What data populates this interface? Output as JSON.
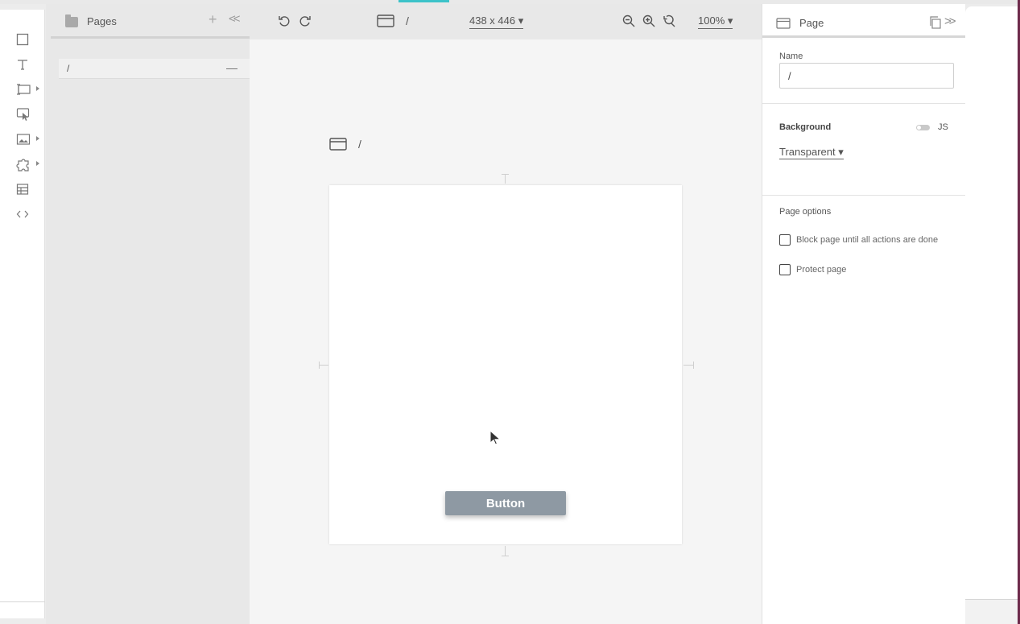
{
  "pages_panel": {
    "title": "Pages",
    "add_label": "+",
    "collapse_label": "<<",
    "pages": [
      {
        "label": "/"
      }
    ]
  },
  "canvas_toolbar": {
    "breadcrumb": "/",
    "size_label": "438 x 446 ▾",
    "zoom_label": "100% ▾"
  },
  "canvas": {
    "frame_title": "/",
    "button_label": "Button"
  },
  "properties": {
    "title": "Page",
    "expand_label": ">>",
    "name_label": "Name",
    "name_value": "/",
    "background_label": "Background",
    "js_label": "JS",
    "background_value": "Transparent ▾",
    "page_options_label": "Page options",
    "options": [
      {
        "label": "Block page until all actions are done",
        "checked": false
      },
      {
        "label": "Protect page",
        "checked": false
      }
    ]
  },
  "colors": {
    "accent": "#3cc3c9",
    "frame_button": "#8e99a3",
    "window_border": "#6d2a4b"
  },
  "icons": {
    "toolbar": [
      "rectangle-icon",
      "text-icon",
      "input-icon",
      "click-icon",
      "image-icon",
      "plugin-icon",
      "table-icon",
      "code-icon"
    ]
  }
}
